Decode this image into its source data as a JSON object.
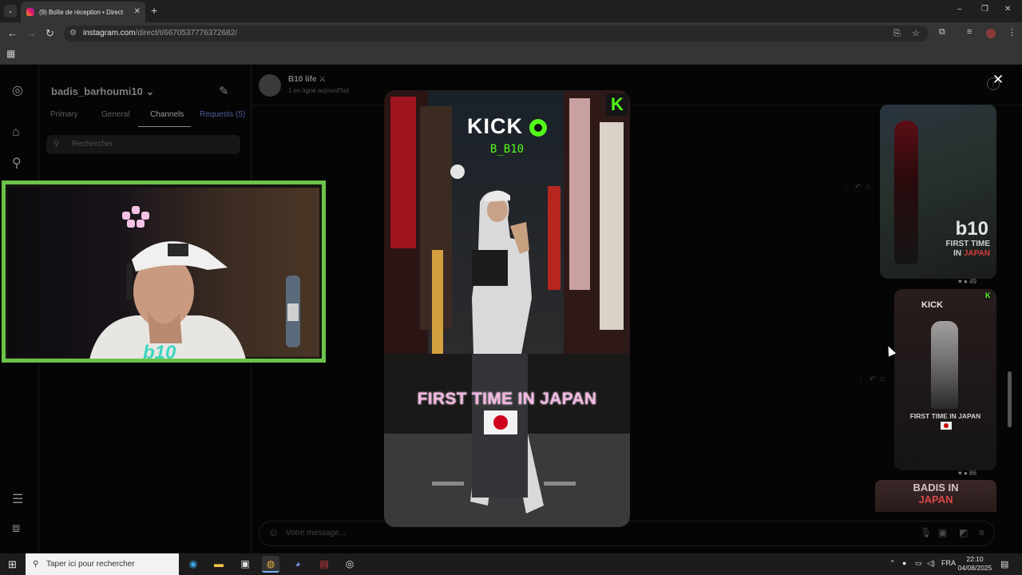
{
  "browser": {
    "tab_title": "(9) Boîte de réception • Direct",
    "new_tab": "+",
    "url_domain": "instagram.com",
    "url_path": "/direct/t/6670537776372682/",
    "window_controls": [
      "–",
      "❐",
      "✕"
    ]
  },
  "instagram": {
    "username": "badis_barhoumi10",
    "tabs": [
      "Primary",
      "General",
      "Channels",
      "Requests (5)"
    ],
    "active_tab": "Channels",
    "search_placeholder": "Rechercher",
    "chat_name": "B10 life",
    "chat_status": "1 en ligne aujourd'hui",
    "composer_placeholder": "Votre message...",
    "thumb1": {
      "big": "b10",
      "line1": "FIRST TIME",
      "line2_prefix": "IN ",
      "line2_red": "JAPAN",
      "reactions": "49"
    },
    "thumb2": {
      "kick": "KICK",
      "badge": "K",
      "title": "FIRST TIME IN JAPAN",
      "reactions": "86"
    },
    "thumb3": {
      "line1": "BADIS IN",
      "line2": "JAPAN"
    }
  },
  "reel": {
    "kick_text": "KICK",
    "handle": "B_B10",
    "badge": "K",
    "title": "FIRST TIME IN JAPAN",
    "close_symbol": "✕"
  },
  "webcam": {
    "logo_text": "b10"
  },
  "taskbar": {
    "search_placeholder": "Taper ici pour rechercher",
    "language": "FRA",
    "time": "22:10",
    "date": "04/08/2025"
  },
  "colors": {
    "kick_green": "#53fc18",
    "webcam_border": "#6cc24a",
    "reel_title_pink": "#f4b5e2",
    "japan_red": "#d0021b"
  }
}
